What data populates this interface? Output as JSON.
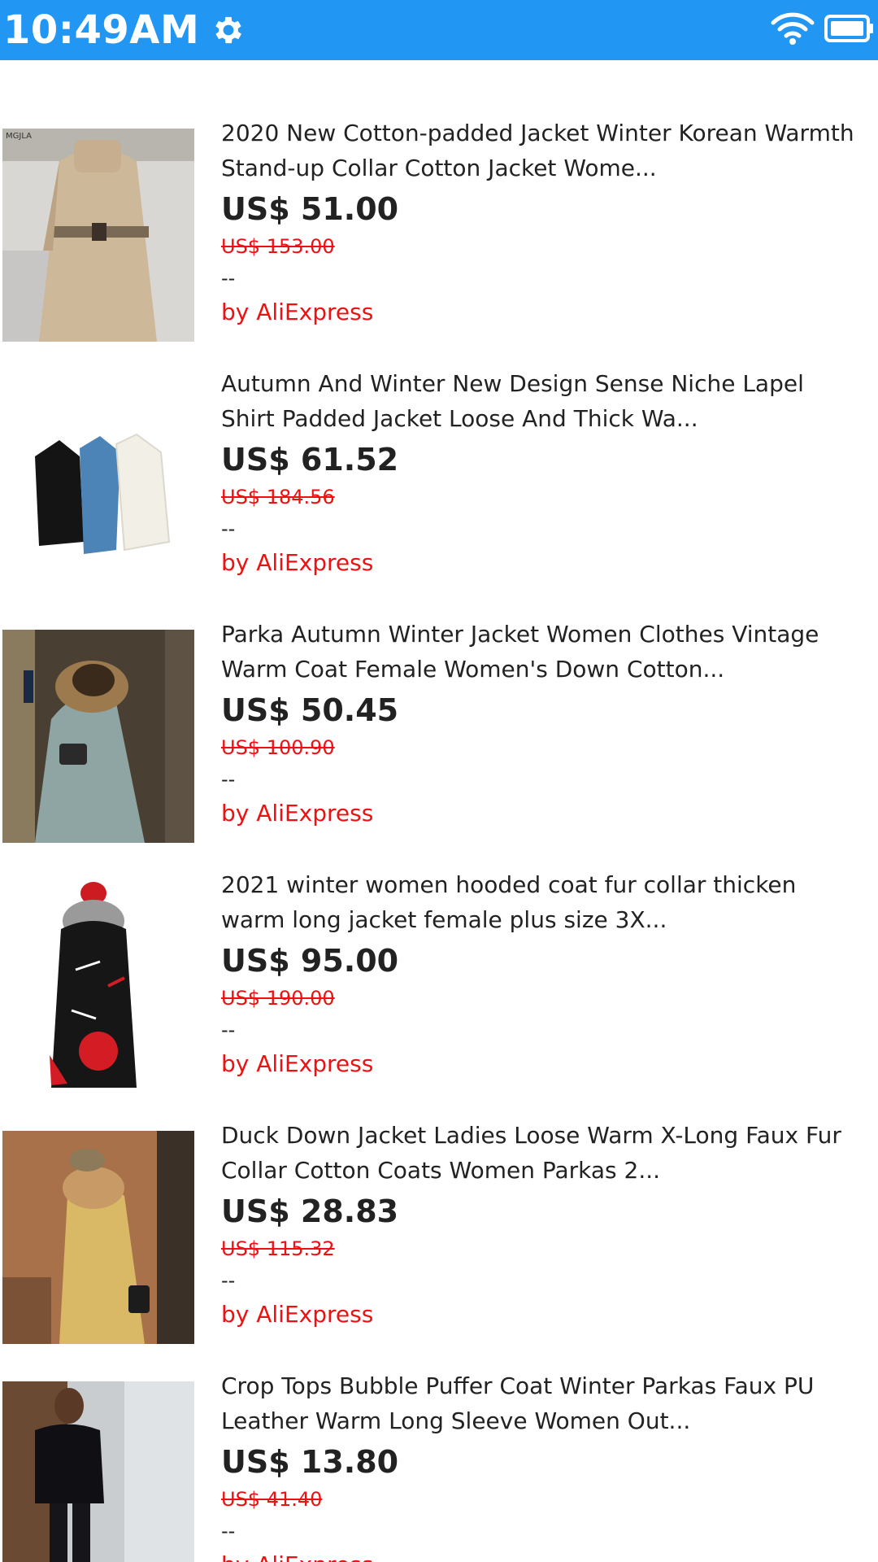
{
  "status_bar": {
    "time": "10:49AM",
    "background": "#2196f3"
  },
  "products": [
    {
      "title": "2020 New Cotton-padded Jacket Winter Korean Warmth\nStand-up Collar Cotton Jacket Wome...",
      "price": "US$ 51.00",
      "old_price": "US$ 153.00",
      "rating": "--",
      "seller": "by AliExpress",
      "image_text": "MGJLA"
    },
    {
      "title": "Autumn And Winter New Design Sense Niche Lapel\nShirt Padded Jacket Loose And Thick Wa...",
      "price": "US$ 61.52",
      "old_price": "US$ 184.56",
      "rating": "--",
      "seller": "by AliExpress"
    },
    {
      "title": "Parka Autumn Winter Jacket Women Clothes Vintage\nWarm Coat Female Women's Down Cotton...",
      "price": "US$ 50.45",
      "old_price": "US$ 100.90",
      "rating": "--",
      "seller": "by AliExpress"
    },
    {
      "title": "2021 winter women hooded coat fur collar thicken\nwarm long jacket female plus size 3X...",
      "price": "US$ 95.00",
      "old_price": "US$ 190.00",
      "rating": "--",
      "seller": "by AliExpress"
    },
    {
      "title": "Duck Down Jacket Ladies Loose Warm X-Long Faux Fur\nCollar Cotton Coats Women Parkas 2...",
      "price": "US$ 28.83",
      "old_price": "US$ 115.32",
      "rating": "--",
      "seller": "by AliExpress"
    },
    {
      "title": "Crop Tops Bubble Puffer Coat Winter Parkas Faux PU\nLeather Warm Long Sleeve Women Out...",
      "price": "US$ 13.80",
      "old_price": "US$ 41.40",
      "rating": "--",
      "seller": "by AliExpress"
    }
  ]
}
